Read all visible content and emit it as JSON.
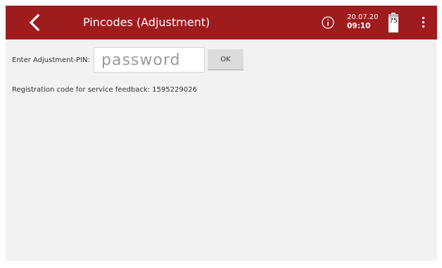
{
  "header": {
    "title": "Pincodes (Adjustment)",
    "date": "20.07.20",
    "time": "09:10",
    "battery_level": "75",
    "accent_color": "#9e1b1e",
    "icons": [
      "back-arrow-icon",
      "info-icon",
      "battery-icon",
      "more-vert-icon"
    ]
  },
  "pin": {
    "label": "Enter Adjustment-PIN:",
    "placeholder": "password",
    "value": "",
    "ok_label": "OK"
  },
  "registration": {
    "label": "Registration code for service feedback:",
    "code": "1595229026"
  }
}
